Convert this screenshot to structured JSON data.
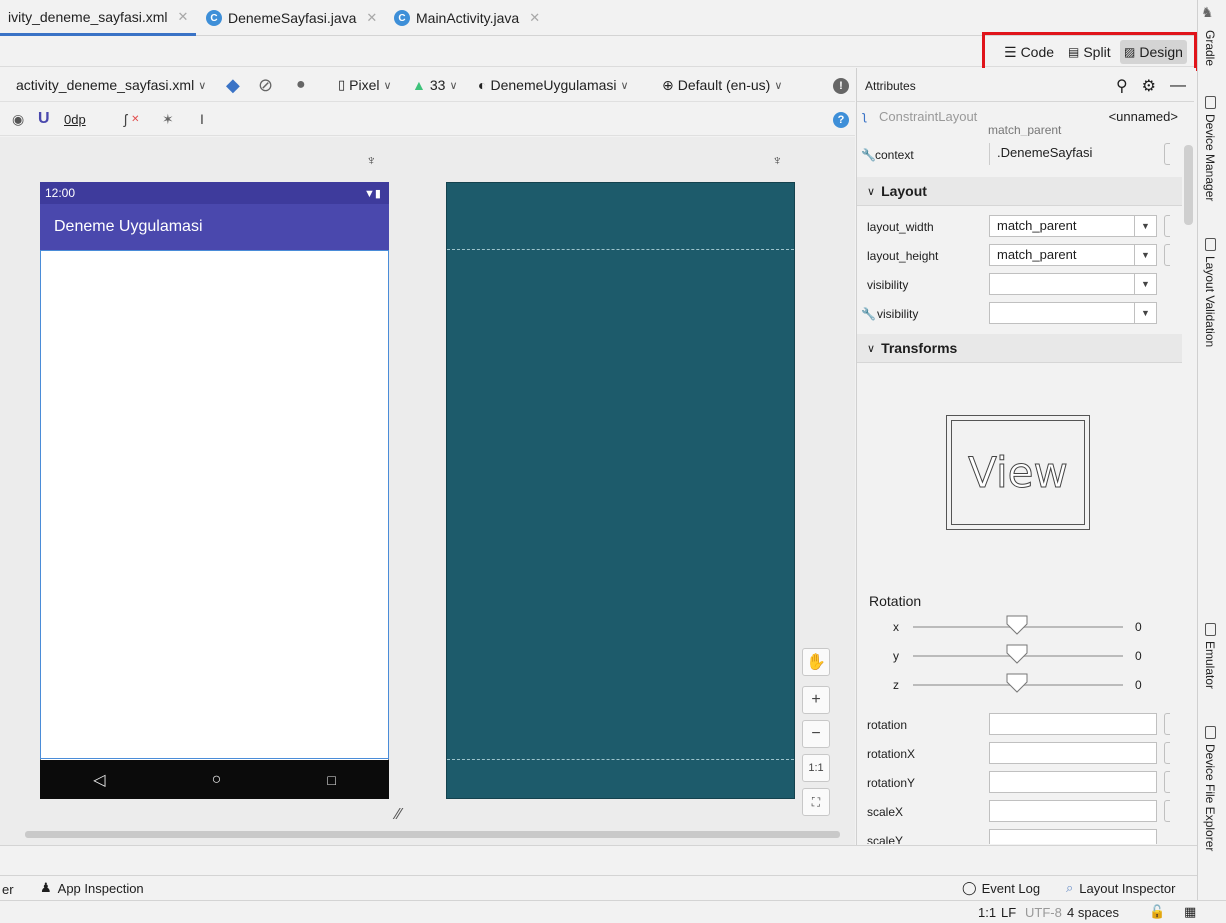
{
  "editor_tabs": [
    {
      "label": "ivity_deneme_sayfasi.xml",
      "active": true
    },
    {
      "label": "DenemeSayfasi.java",
      "icon": "C"
    },
    {
      "label": "MainActivity.java",
      "icon": "C"
    }
  ],
  "view_modes": {
    "code": "Code",
    "split": "Split",
    "design": "Design",
    "selected": "Design"
  },
  "toolbar": {
    "file": "activity_deneme_sayfasi.xml",
    "device": "Pixel",
    "api": "33",
    "theme": "DenemeUygulamasi",
    "locale": "Default (en-us)",
    "margin": "0dp"
  },
  "phone": {
    "time": "12:00",
    "app_title": "Deneme Uygulamasi"
  },
  "zoom": {
    "hand": "✋",
    "plus": "+",
    "minus": "−",
    "one_to_one": "1:1"
  },
  "attributes": {
    "title": "Attributes",
    "component": "ConstraintLayout",
    "component_id": "<unnamed>",
    "partial_value": "match_parent",
    "context_label": "context",
    "context_value": ".DenemeSayfasi",
    "layout_section": "Layout",
    "layout_width_label": "layout_width",
    "layout_width_value": "match_parent",
    "layout_height_label": "layout_height",
    "layout_height_value": "match_parent",
    "visibility_label": "visibility",
    "tools_visibility_label": "visibility",
    "transforms_section": "Transforms",
    "view_preview": "View",
    "rotation_title": "Rotation",
    "rot_x_label": "x",
    "rot_x_value": "0",
    "rot_y_label": "y",
    "rot_y_value": "0",
    "rot_z_label": "z",
    "rot_z_value": "0",
    "rotation_label": "rotation",
    "rotationX_label": "rotationX",
    "rotationY_label": "rotationY",
    "scaleX_label": "scaleX",
    "scaleY_label": "scaleY"
  },
  "right_tools": {
    "gradle": "Gradle",
    "device_manager": "Device Manager",
    "layout_validation": "Layout Validation",
    "emulator": "Emulator",
    "device_file_explorer": "Device File Explorer"
  },
  "bottom_tools": {
    "left_partial": "er",
    "app_inspection": "App Inspection",
    "event_log": "Event Log",
    "layout_inspector": "Layout Inspector"
  },
  "status": {
    "position": "1:1",
    "line_sep": "LF",
    "encoding": "UTF-8",
    "indent": "4 spaces"
  },
  "colors": {
    "accent": "#3a73c6",
    "app_bar": "#4a48ad",
    "status_bar": "#3e3b9c",
    "blueprint": "#1d5b6b",
    "highlight_box": "#e0141a"
  }
}
